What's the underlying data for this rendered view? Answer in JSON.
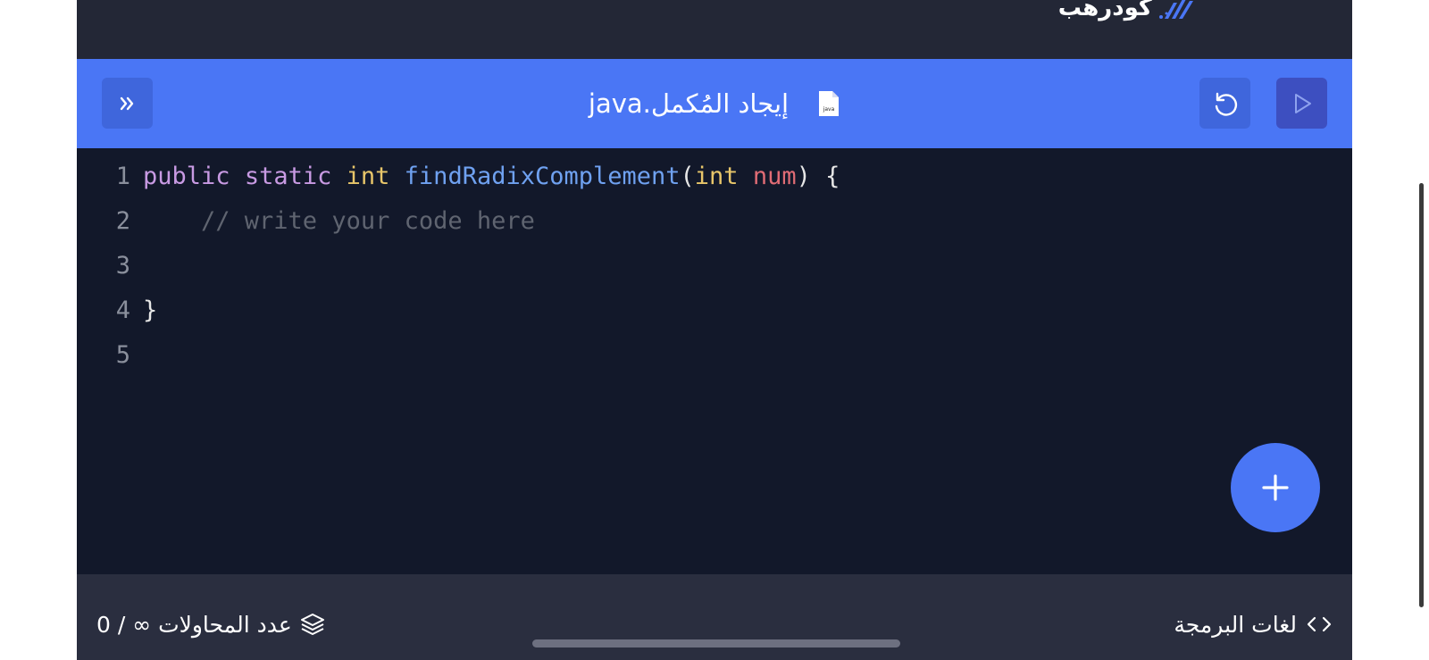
{
  "brand": {
    "logo_text": "كودرهب"
  },
  "file_bar": {
    "file_name": "إيجاد المُكمل.java",
    "file_icon_label": "java",
    "expand_icon": "double-chevron-icon",
    "reset_icon": "reset-icon",
    "run_icon": "play-icon"
  },
  "editor": {
    "line_numbers": [
      "1",
      "2",
      "3",
      "4",
      "5"
    ],
    "line1": {
      "kw1": "public",
      "kw2": "static",
      "type1": "int",
      "fn": "findRadixComplement",
      "open": "(",
      "type2": "int",
      "param": "num",
      "close": ") {"
    },
    "line2": "    // write your code here",
    "line4": "}"
  },
  "fab_icon": "plus-icon",
  "footer": {
    "attempts_label": "عدد المحاولات",
    "attempts_value": "0 / ∞",
    "languages_label": "لغات البرمجة",
    "languages_icon": "code-icon"
  },
  "colors": {
    "accent": "#4a76f5",
    "editor_bg": "#12182a",
    "frame_bg": "#232736",
    "footer_bg": "#2a2e3f"
  }
}
